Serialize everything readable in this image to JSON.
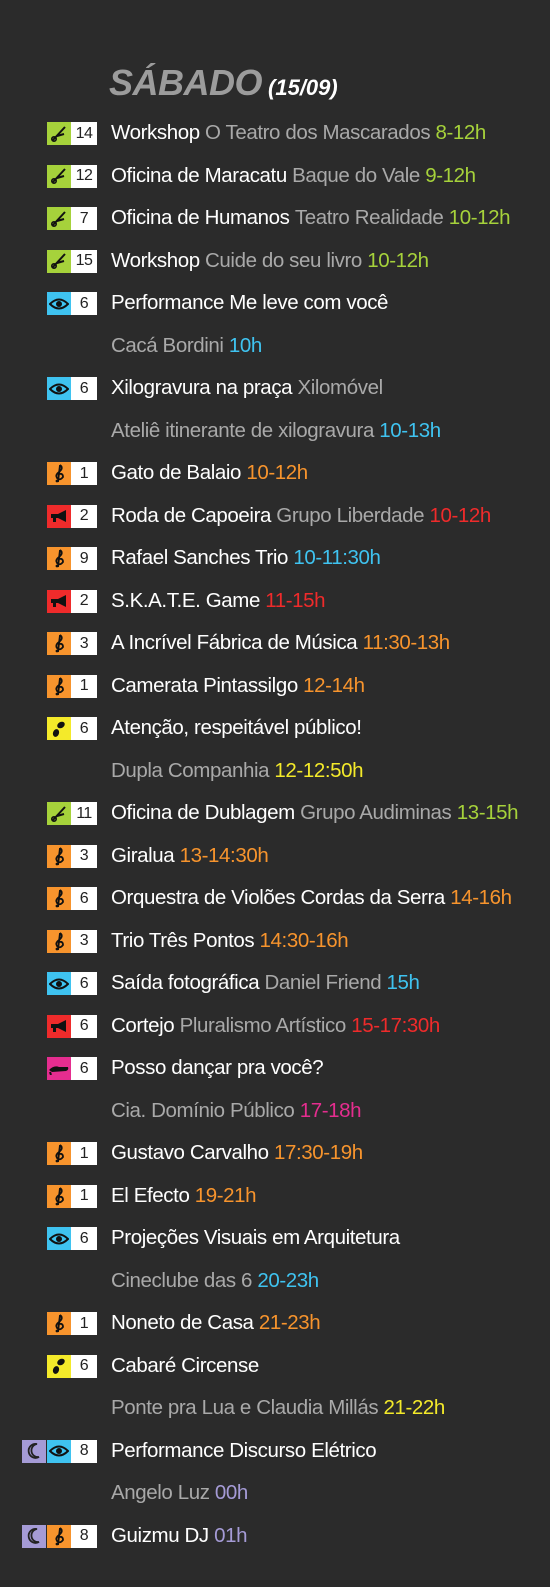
{
  "header": {
    "day": "SÁBADO",
    "date": "(15/09)"
  },
  "colors": {
    "workshop": "#a6d23b",
    "visual": "#3fc3f0",
    "music": "#f7942d",
    "street": "#ef2b2b",
    "circus": "#f4ea2a",
    "dance": "#e52d8f",
    "night": "#a59bd6"
  },
  "entries": [
    {
      "cat": "workshop",
      "icon": "scissors-icon",
      "num": "14",
      "lines": [
        [
          "Workshop",
          "O Teatro dos Mascarados",
          "8-12h"
        ]
      ]
    },
    {
      "cat": "workshop",
      "icon": "scissors-icon",
      "num": "12",
      "lines": [
        [
          "Oficina de Maracatu",
          "Baque do Vale",
          "9-12h"
        ]
      ]
    },
    {
      "cat": "workshop",
      "icon": "scissors-icon",
      "num": "7",
      "lines": [
        [
          "Oficina de Humanos",
          "Teatro Realidade",
          "10-12h"
        ]
      ]
    },
    {
      "cat": "workshop",
      "icon": "scissors-icon",
      "num": "15",
      "lines": [
        [
          "Workshop",
          "Cuide do seu livro",
          "10-12h"
        ]
      ]
    },
    {
      "cat": "visual",
      "icon": "eye-icon",
      "num": "6",
      "lines": [
        [
          "Performance Me leve com você",
          "",
          ""
        ],
        [
          "",
          "Cacá Bordini",
          "10h"
        ]
      ]
    },
    {
      "cat": "visual",
      "icon": "eye-icon",
      "num": "6",
      "lines": [
        [
          "Xilogravura na praça",
          "Xilomóvel",
          ""
        ],
        [
          "",
          "Ateliê itinerante de xilogravura",
          "10-13h"
        ]
      ]
    },
    {
      "cat": "music",
      "icon": "treble-clef-icon",
      "num": "1",
      "lines": [
        [
          "Gato de Balaio",
          "",
          "10-12h"
        ]
      ]
    },
    {
      "cat": "street",
      "icon": "megaphone-icon",
      "num": "2",
      "lines": [
        [
          "Roda de Capoeira",
          "Grupo Liberdade",
          "10-12h"
        ]
      ]
    },
    {
      "cat": "music",
      "icon": "treble-clef-icon",
      "num": "9",
      "lines": [
        [
          "Rafael Sanches Trio",
          "",
          "10-11:30h"
        ]
      ],
      "timecolor": "visual"
    },
    {
      "cat": "street",
      "icon": "megaphone-icon",
      "num": "2",
      "lines": [
        [
          "S.K.A.T.E. Game",
          "",
          "11-15h"
        ]
      ]
    },
    {
      "cat": "music",
      "icon": "treble-clef-icon",
      "num": "3",
      "lines": [
        [
          "A Incrível Fábrica de Música",
          "",
          "11:30-13h"
        ]
      ]
    },
    {
      "cat": "music",
      "icon": "treble-clef-icon",
      "num": "1",
      "lines": [
        [
          "Camerata Pintassilgo",
          "",
          "12-14h"
        ]
      ]
    },
    {
      "cat": "circus",
      "icon": "juggling-icon",
      "num": "6",
      "lines": [
        [
          "Atenção, respeitável público!",
          "",
          ""
        ],
        [
          "",
          "Dupla Companhia",
          "12-12:50h"
        ]
      ]
    },
    {
      "cat": "workshop",
      "icon": "scissors-icon",
      "num": "11",
      "lines": [
        [
          "Oficina de Dublagem",
          "Grupo Audiminas",
          "13-15h"
        ]
      ]
    },
    {
      "cat": "music",
      "icon": "treble-clef-icon",
      "num": "3",
      "lines": [
        [
          "Giralua",
          "",
          "13-14:30h"
        ]
      ]
    },
    {
      "cat": "music",
      "icon": "treble-clef-icon",
      "num": "6",
      "lines": [
        [
          "Orquestra de Violões Cordas da Serra",
          "",
          "14-16h"
        ]
      ]
    },
    {
      "cat": "music",
      "icon": "treble-clef-icon",
      "num": "3",
      "lines": [
        [
          "Trio Três Pontos",
          "",
          "14:30-16h"
        ]
      ]
    },
    {
      "cat": "visual",
      "icon": "eye-icon",
      "num": "6",
      "lines": [
        [
          "Saída fotográfica",
          "Daniel Friend",
          "15h"
        ]
      ]
    },
    {
      "cat": "street",
      "icon": "megaphone-icon",
      "num": "6",
      "lines": [
        [
          "Cortejo",
          "Pluralismo Artístico",
          "15-17:30h"
        ]
      ]
    },
    {
      "cat": "dance",
      "icon": "shoe-icon",
      "num": "6",
      "lines": [
        [
          "Posso dançar pra você?",
          "",
          ""
        ],
        [
          "",
          "Cia. Domínio Público",
          "17-18h"
        ]
      ]
    },
    {
      "cat": "music",
      "icon": "treble-clef-icon",
      "num": "1",
      "lines": [
        [
          "Gustavo Carvalho",
          "",
          "17:30-19h"
        ]
      ]
    },
    {
      "cat": "music",
      "icon": "treble-clef-icon",
      "num": "1",
      "lines": [
        [
          "El Efecto",
          "",
          "19-21h"
        ]
      ]
    },
    {
      "cat": "visual",
      "icon": "eye-icon",
      "num": "6",
      "lines": [
        [
          "Projeções Visuais em Arquitetura",
          "",
          ""
        ],
        [
          "",
          "Cineclube das 6",
          "20-23h"
        ]
      ]
    },
    {
      "cat": "music",
      "icon": "treble-clef-icon",
      "num": "1",
      "lines": [
        [
          "Noneto de Casa",
          "",
          "21-23h"
        ]
      ]
    },
    {
      "cat": "circus",
      "icon": "juggling-icon",
      "num": "6",
      "lines": [
        [
          "Cabaré Circense",
          "",
          ""
        ],
        [
          "",
          "Ponte pra Lua e Claudia Millás",
          "21-22h"
        ]
      ]
    },
    {
      "cat": "visual",
      "icon": "eye-icon",
      "num": "8",
      "night": true,
      "lines": [
        [
          "Performance Discurso Elétrico",
          "",
          ""
        ],
        [
          "",
          "Angelo Luz",
          "00h"
        ]
      ],
      "timecolor": "night"
    },
    {
      "cat": "music",
      "icon": "treble-clef-icon",
      "num": "8",
      "night": true,
      "lines": [
        [
          "Guizmu DJ",
          "",
          "01h"
        ]
      ],
      "timecolor": "night"
    }
  ]
}
